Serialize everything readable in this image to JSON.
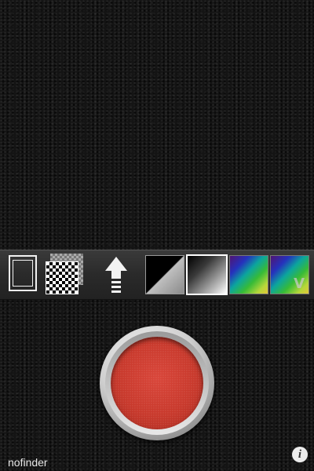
{
  "toolbar": {
    "tools": [
      {
        "name": "frame-border",
        "icon": "frame-icon"
      },
      {
        "name": "checkerboard",
        "icon": "checkerboard-icon"
      },
      {
        "name": "upload",
        "icon": "up-arrow-icon"
      },
      {
        "name": "black-gray-split",
        "icon": "split-gray-icon"
      },
      {
        "name": "black-white-gradient",
        "icon": "gradient-gray-icon"
      },
      {
        "name": "rainbow",
        "icon": "rainbow-gradient-icon"
      },
      {
        "name": "rainbow-v",
        "icon": "rainbow-gradient-v-icon",
        "label": "V"
      }
    ]
  },
  "shutter": {
    "color": "#c8392c"
  },
  "footer": {
    "brand": "nofinder",
    "info_symbol": "i"
  }
}
